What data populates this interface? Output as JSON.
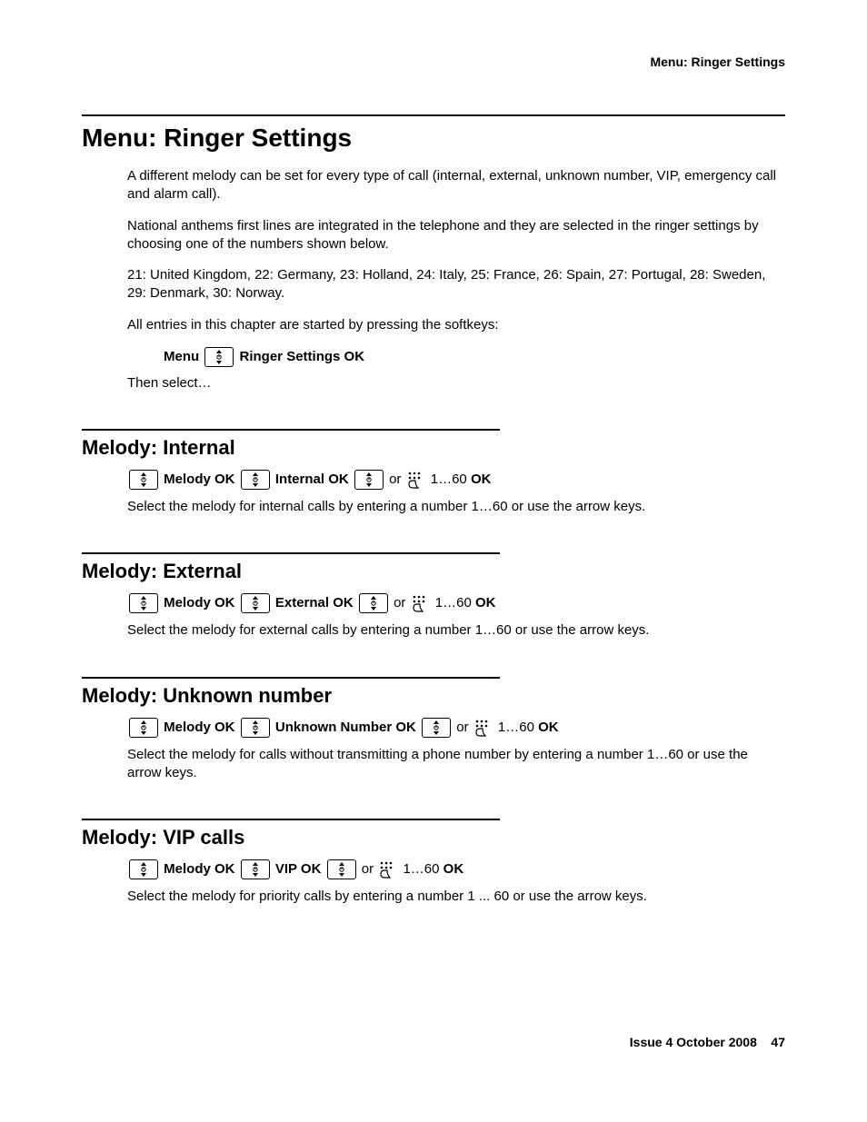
{
  "header": {
    "running": "Menu: Ringer Settings"
  },
  "title": "Menu: Ringer Settings",
  "intro": {
    "p1": "A different melody can be set for every type of call (internal, external, unknown number, VIP, emergency call and alarm call).",
    "p2": "National anthems first lines are integrated in the telephone and they are selected in the ringer settings by choosing one of the numbers shown below.",
    "p3": "21: United Kingdom, 22: Germany, 23: Holland, 24: Italy, 25: France, 26: Spain, 27: Portugal, 28: Sweden, 29: Denmark, 30: Norway.",
    "p4": "All entries in this chapter are started by pressing the softkeys:",
    "softkeys_prefix": "Menu",
    "softkeys_suffix": "Ringer Settings OK",
    "then": "Then select…"
  },
  "sections": {
    "internal": {
      "heading": "Melody: Internal",
      "nav_1": "Melody OK",
      "nav_2": "Internal OK",
      "nav_or": "or",
      "nav_range": "1…60",
      "nav_ok": "OK",
      "desc": "Select the melody for internal calls by entering a number 1…60 or use the arrow keys."
    },
    "external": {
      "heading": "Melody: External",
      "nav_1": "Melody OK",
      "nav_2": "External OK",
      "nav_or": "or",
      "nav_range": "1…60",
      "nav_ok": "OK",
      "desc": "Select the melody for external calls by entering a number 1…60 or use the arrow keys."
    },
    "unknown": {
      "heading": "Melody: Unknown number",
      "nav_1": "Melody OK",
      "nav_2": "Unknown Number OK",
      "nav_or": "or",
      "nav_range": "1…60",
      "nav_ok": "OK",
      "desc": "Select the melody for calls without transmitting a phone number by entering a number 1…60 or use the arrow keys."
    },
    "vip": {
      "heading": "Melody: VIP calls",
      "nav_1": "Melody OK",
      "nav_2": "VIP OK",
      "nav_or": "or",
      "nav_range": "1…60",
      "nav_ok": "OK",
      "desc": "Select the melody for priority calls by entering a number 1 ... 60 or use the arrow keys."
    }
  },
  "footer": {
    "issue": "Issue 4   October 2008",
    "page": "47"
  }
}
